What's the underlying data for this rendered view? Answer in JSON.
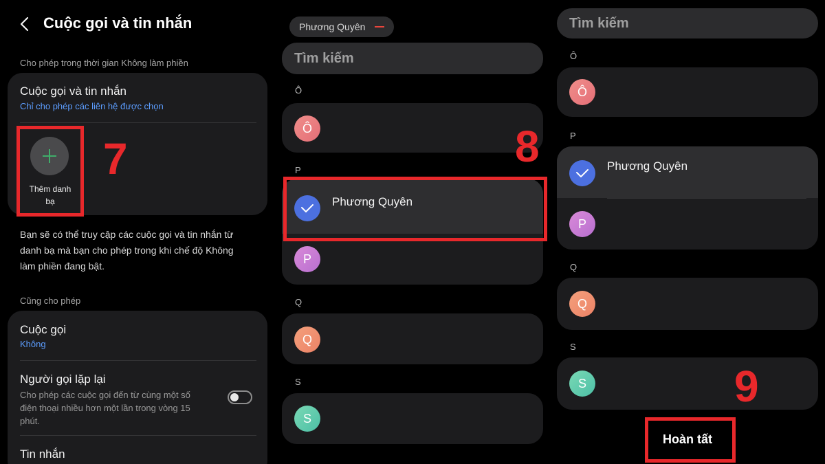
{
  "panel1": {
    "title": "Cuộc gọi và tin nhắn",
    "section_allow": "Cho phép trong thời gian Không làm phiền",
    "calls_messages_title": "Cuộc gọi và tin nhắn",
    "calls_messages_sub": "Chỉ cho phép các liên hệ được chọn",
    "add_contact_line1": "Thêm danh",
    "add_contact_line2": "bạ",
    "step": "7",
    "desc_line1": "Bạn sẽ có thể truy cập các cuộc gọi và tin nhắn từ",
    "desc_line2": "danh bạ mà bạn cho phép trong khi chế độ Không",
    "desc_line3": "làm phiền đang bật.",
    "section_also": "Cũng cho phép",
    "calls_title": "Cuộc gọi",
    "calls_sub": "Không",
    "repeat_title": "Người gọi lặp lại",
    "repeat_line1": "Cho phép các cuộc gọi đến từ cùng một số",
    "repeat_line2": "điện thoại nhiều hơn một lần trong vòng 15",
    "repeat_line3": "phút.",
    "messages_title": "Tin nhắn"
  },
  "panel2": {
    "chip": "Phương Quyên",
    "search_placeholder": "Tìm kiếm",
    "step": "8",
    "letters": [
      "Ô",
      "P",
      "Q",
      "S"
    ],
    "contact_o": "Ô",
    "selected_name": "Phương Quyên",
    "contact_p": "P",
    "contact_q": "Q",
    "contact_s": "S"
  },
  "panel3": {
    "search_placeholder": "Tìm kiếm",
    "letters": [
      "Ô",
      "P",
      "Q",
      "S"
    ],
    "contact_o": "Ô",
    "selected_name": "Phương Quyên",
    "contact_p": "P",
    "contact_q": "Q",
    "contact_s": "S",
    "step": "9",
    "done_label": "Hoàn tất"
  },
  "colors": {
    "accent_blue": "#5c9dff",
    "highlight_red": "#e8282b",
    "check_blue": "#4c70e0",
    "add_plus_green": "#3fae6a"
  }
}
